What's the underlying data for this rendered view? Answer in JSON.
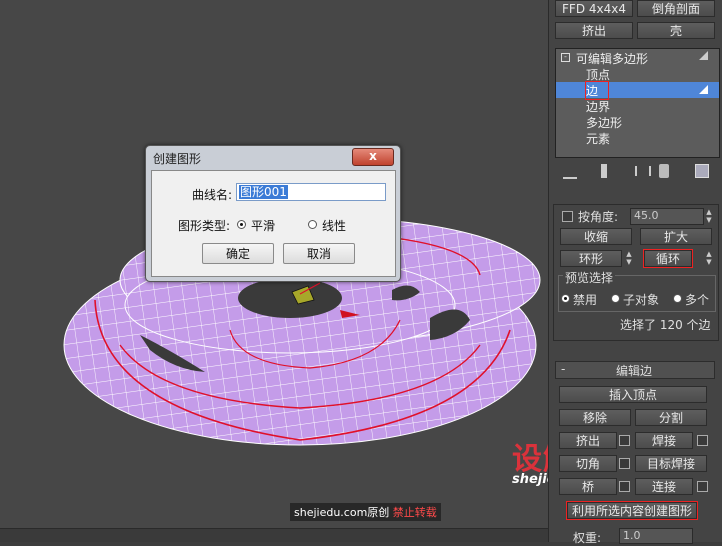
{
  "panel": {
    "top_buttons": [
      "FFD 4x4x4",
      "倒角剖面",
      "挤出",
      "壳"
    ],
    "stack": {
      "root": "可编辑多边形",
      "items": [
        "顶点",
        "边",
        "边界",
        "多边形",
        "元素"
      ],
      "selected_index": 1
    },
    "selection": {
      "by_angle_label": "按角度:",
      "by_angle_value": "45.0",
      "shrink": "收缩",
      "grow": "扩大",
      "ring": "环形",
      "loop": "循环",
      "preview_label": "预览选择",
      "preview_options": [
        "禁用",
        "子对象",
        "多个"
      ],
      "preview_selected": 0,
      "status": "选择了 120 个边"
    },
    "edit_edges": {
      "title": "编辑边",
      "collapse_sign": "-",
      "insert_vertex": "插入顶点",
      "remove": "移除",
      "split": "分割",
      "extrude": "挤出",
      "weld": "焊接",
      "chamfer": "切角",
      "target_weld": "目标焊接",
      "bridge": "桥",
      "connect": "连接",
      "create_shape": "利用所选内容创建图形",
      "weight_label": "权重:",
      "weight_value": "1.0"
    }
  },
  "dialog": {
    "title": "创建图形",
    "curve_name_label": "曲线名:",
    "curve_name_value": "图形001",
    "shape_type_label": "图形类型:",
    "options": [
      "平滑",
      "线性"
    ],
    "selected_option": 0,
    "ok": "确定",
    "cancel": "取消",
    "close_glyph": "x"
  },
  "watermark": {
    "logo_text": "设解读",
    "domain": "shejiedu.com",
    "footer_domain": "shejiedu.com",
    "footer_original": "原创",
    "footer_warning": "禁止转载"
  },
  "colors": {
    "mesh_fill": "#c49ce9",
    "mesh_line": "#ffffff",
    "edge_selected": "#e0102a",
    "selection_highlight": "#4f86d8",
    "watermark_red": "#e8313a"
  }
}
